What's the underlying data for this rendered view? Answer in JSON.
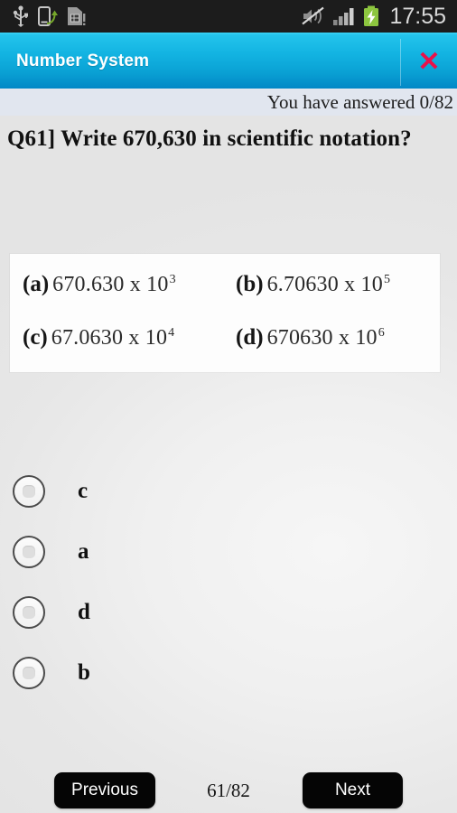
{
  "statusbar": {
    "time": "17:55",
    "left_icons": [
      "usb-icon",
      "phone-transfer-icon",
      "sim-card-alert-icon"
    ],
    "right_icons": [
      "mute-icon",
      "signal-bars-icon",
      "battery-charging-icon"
    ]
  },
  "actionbar": {
    "title": "Number System",
    "close_label": "✕"
  },
  "progress": {
    "answered_text": "You have answered 0/82"
  },
  "question": {
    "text": "Q61]  Write 670,630 in scientific notation?"
  },
  "options_image": {
    "alt": "scanned answer options",
    "cells": [
      {
        "tag": "(a)",
        "mantissa": "670.630 x 10",
        "exponent": "3"
      },
      {
        "tag": "(b)",
        "mantissa": "6.70630 x 10",
        "exponent": "5"
      },
      {
        "tag": "(c)",
        "mantissa": "67.0630 x 10",
        "exponent": "4"
      },
      {
        "tag": "(d)",
        "mantissa": "670630 x 10",
        "exponent": "6"
      }
    ]
  },
  "choices": [
    {
      "label": "c",
      "selected": false
    },
    {
      "label": "a",
      "selected": false
    },
    {
      "label": "d",
      "selected": false
    },
    {
      "label": "b",
      "selected": false
    }
  ],
  "bottombar": {
    "previous_label": "Previous",
    "next_label": "Next",
    "pager": "61/82"
  },
  "colors": {
    "accent_cyan": "#13b4e2",
    "accent_blue_dark": "#0288c6",
    "close_red": "#e8114b",
    "battery_green": "#8dc63f",
    "statusbar_bg": "#1c1c1c",
    "band_bg": "#e1e6ef",
    "page_bg": "#e6e6e6",
    "button_black": "#050505"
  }
}
